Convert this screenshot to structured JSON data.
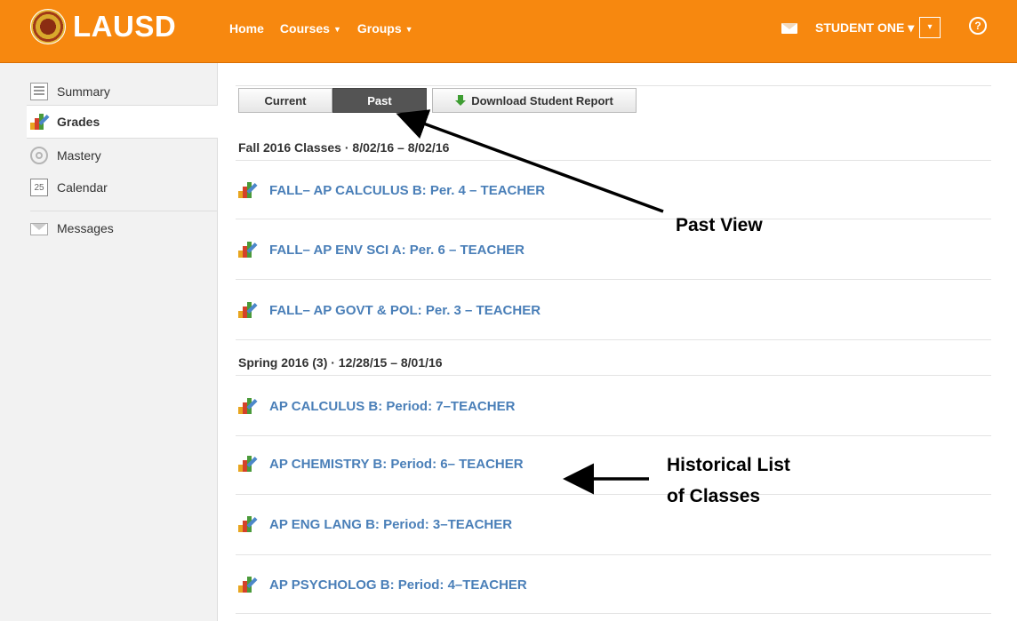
{
  "header": {
    "brand": "LAUSD",
    "nav": [
      {
        "label": "Home"
      },
      {
        "label": "Courses",
        "caret": "▼"
      },
      {
        "label": "Groups",
        "caret": "▼"
      }
    ],
    "user_label": "STUDENT ONE ▾",
    "menu_caret": "▾",
    "help_glyph": "?"
  },
  "sidebar": {
    "items": [
      {
        "label": "Summary",
        "icon": "summary-icon"
      },
      {
        "label": "Grades",
        "icon": "grades-icon",
        "active": true
      },
      {
        "label": "Mastery",
        "icon": "mastery-icon"
      },
      {
        "label": "Calendar",
        "icon": "calendar-icon",
        "icon_text": "25"
      },
      {
        "label": "Messages",
        "icon": "messages-icon"
      }
    ]
  },
  "toolbar": {
    "current_label": "Current",
    "past_label": "Past",
    "download_label": "Download Student Report"
  },
  "terms": [
    {
      "heading": "Fall 2016 Classes · 8/02/16 – 8/02/16",
      "courses": [
        "FALL– AP CALCULUS B: Per. 4 – TEACHER",
        "FALL– AP ENV SCI A: Per. 6 – TEACHER",
        "FALL– AP GOVT & POL: Per. 3 – TEACHER"
      ]
    },
    {
      "heading": "Spring 2016 (3) · 12/28/15 – 8/01/16",
      "courses": [
        "AP CALCULUS B: Period: 7–TEACHER",
        "AP CHEMISTRY B: Period: 6– TEACHER",
        "AP ENG LANG B: Period: 3–TEACHER",
        "AP PSYCHOLOG B: Period: 4–TEACHER"
      ]
    }
  ],
  "annotations": {
    "past_view": "Past View",
    "historical_line1": "Historical List",
    "historical_line2": "of Classes"
  },
  "colors": {
    "header_bg": "#f7880f",
    "link": "#4a7fb8",
    "past_button_bg": "#545454"
  }
}
